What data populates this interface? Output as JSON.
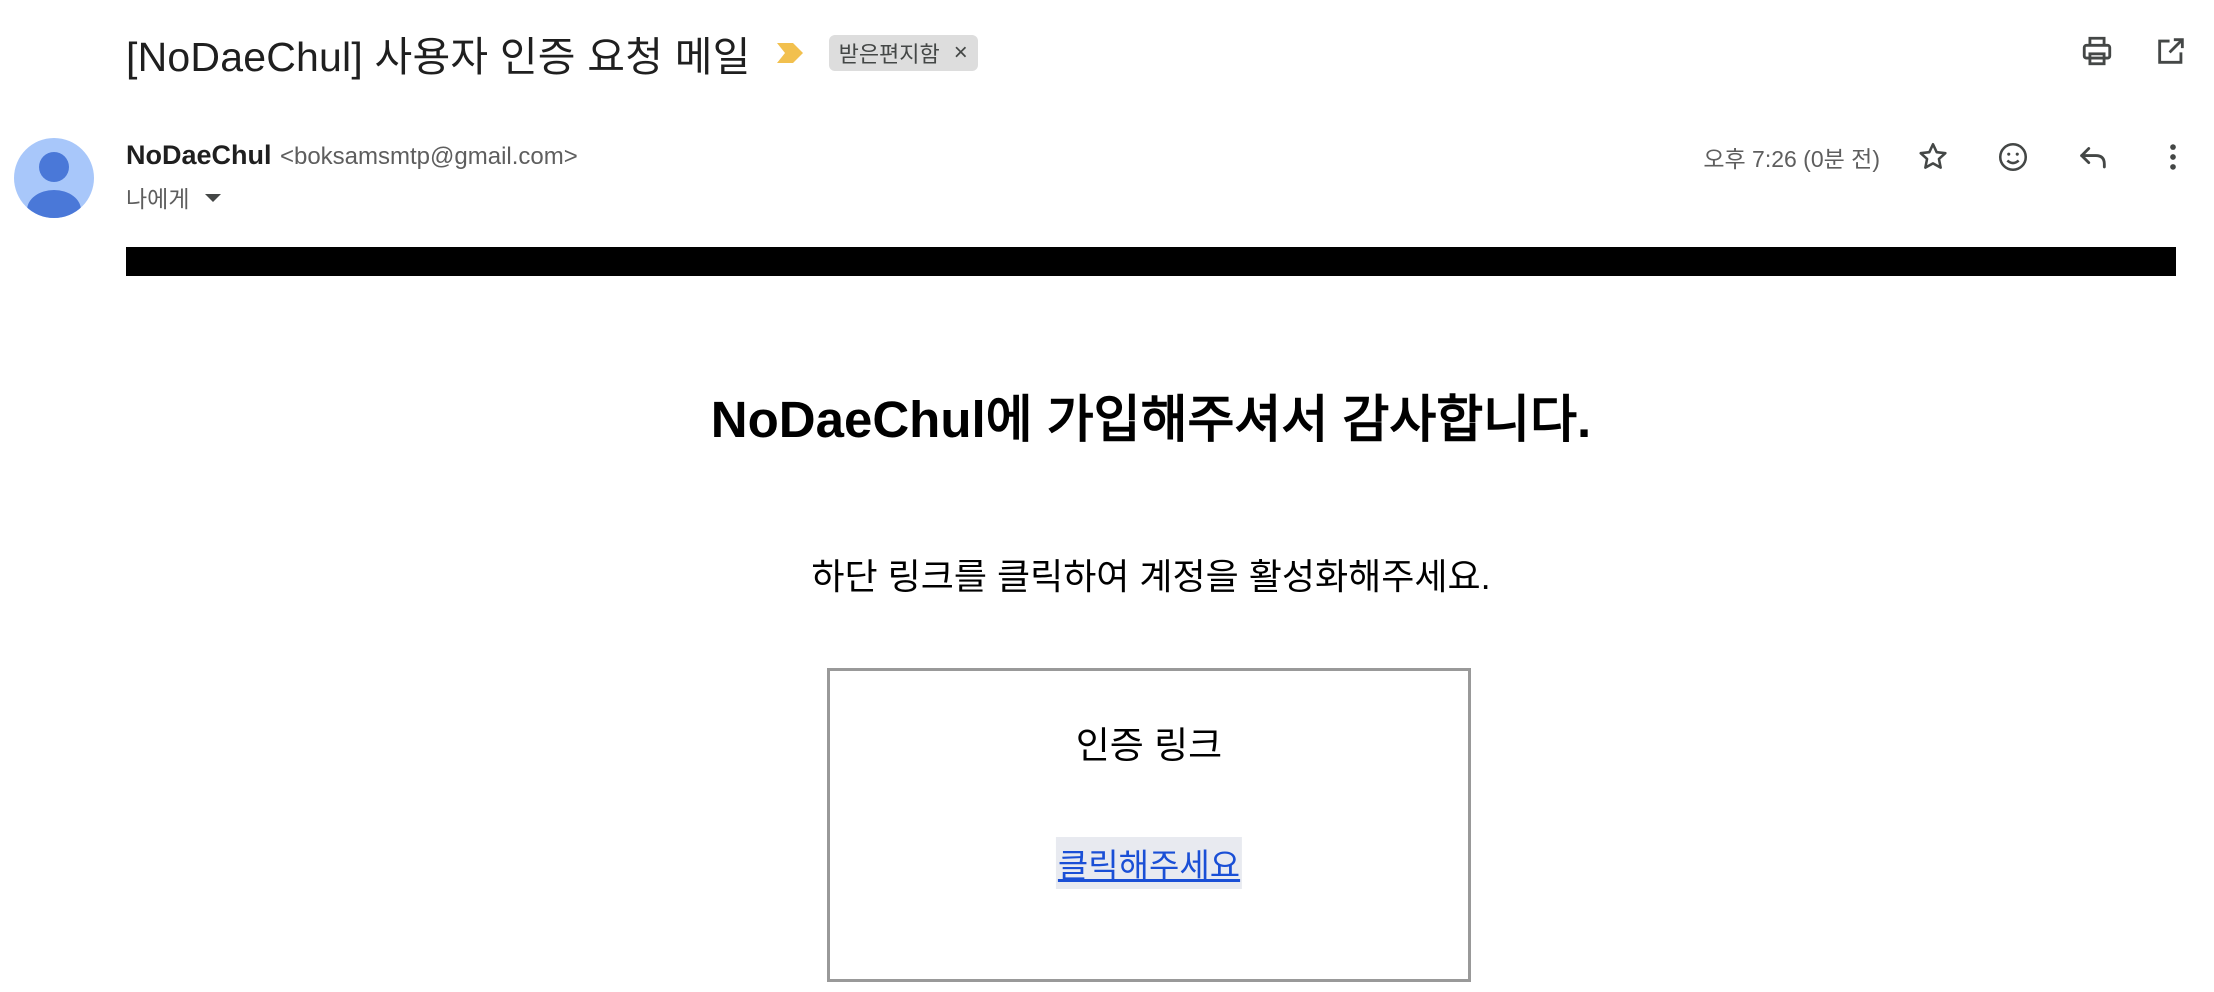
{
  "email": {
    "subject": "[NoDaeChul] 사용자 인증 요청 메일",
    "label": "받은편지함",
    "label_remove": "×",
    "sender_name": "NoDaeChul",
    "sender_email": "<boksamsmtp@gmail.com>",
    "recipient": "나에게",
    "timestamp": "오후 7:26 (0분 전)"
  },
  "body": {
    "heading": "NoDaeChul에 가입해주셔서 감사합니다.",
    "instruction": "하단 링크를 클릭하여 계정을 활성화해주세요.",
    "box_title": "인증 링크",
    "link_text": "클릭해주세요"
  },
  "icons": {
    "importance": "importance-marker-icon",
    "print": "print-icon",
    "open_new_window": "open-in-new-window-icon",
    "star": "star-icon",
    "emoji": "emoji-reaction-icon",
    "reply": "reply-icon",
    "more": "more-vertical-icon",
    "avatar": "default-avatar-icon"
  },
  "colors": {
    "importance": "#f2c04e",
    "avatar_bg": "#a8c7fa",
    "avatar_fg": "#4a78d8",
    "link": "#1a4fd6",
    "chip_bg": "#dddddd"
  }
}
